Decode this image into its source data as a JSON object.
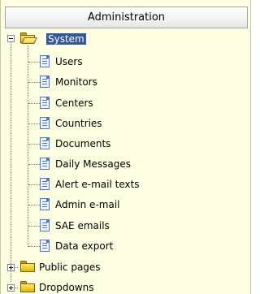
{
  "header": {
    "title": "Administration"
  },
  "tree": {
    "root": {
      "label": "System",
      "expanded": true,
      "selected": true
    },
    "system_children": [
      {
        "label": "Users"
      },
      {
        "label": "Monitors"
      },
      {
        "label": "Centers"
      },
      {
        "label": "Countries"
      },
      {
        "label": "Documents"
      },
      {
        "label": "Daily Messages"
      },
      {
        "label": "Alert e-mail texts"
      },
      {
        "label": "Admin e-mail"
      },
      {
        "label": "SAE emails"
      },
      {
        "label": "Data export"
      }
    ],
    "folders": [
      {
        "label": "Public pages",
        "expanded": false
      },
      {
        "label": "Dropdowns",
        "expanded": false
      }
    ]
  },
  "colors": {
    "panel_background": "#fffde2",
    "selection": "#33579a",
    "folder": "#e2b800",
    "page_icon": "#4a78c8"
  }
}
